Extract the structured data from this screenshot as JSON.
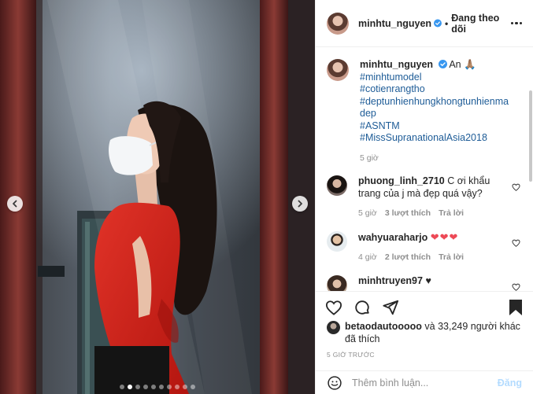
{
  "header": {
    "username": "minhtu_nguyen",
    "separator": "•",
    "follow_label": "Đang theo dõi"
  },
  "caption": {
    "username": "minhtu_nguyen",
    "text": "An 🙏🏽",
    "hashtags": [
      "#minhtumodel",
      "#cotienrangtho",
      "#deptunhienhungkhongtunhienmadep",
      "#ASNTM",
      "#MissSupranationalAsia2018"
    ],
    "time": "5 giờ"
  },
  "comments": [
    {
      "username": "phuong_linh_2710",
      "text": "C ơi khẩu trang của j mà đẹp quá vậy?",
      "time": "5 giờ",
      "likes": "3 lượt thích",
      "reply": "Trả lời"
    },
    {
      "username": "wahyuaraharjo",
      "text": "❤❤❤",
      "time": "4 giờ",
      "likes": "2 lượt thích",
      "reply": "Trả lời"
    },
    {
      "username": "minhtruyen97",
      "text": "♥"
    }
  ],
  "likes_summary": {
    "first_user": "betaodautooooo",
    "rest": "và 33,249 người khác",
    "suffix": "đã thích"
  },
  "posted_ago": "5 GIỜ TRƯỚC",
  "add_comment": {
    "placeholder": "Thêm bình luận...",
    "post_label": "Đăng"
  },
  "carousel": {
    "total": 10,
    "active_index": 1
  },
  "colors": {
    "link": "#1e5c97",
    "verified": "#3897f0",
    "heart": "#ed4956",
    "post_disabled": "#b3dbff"
  }
}
